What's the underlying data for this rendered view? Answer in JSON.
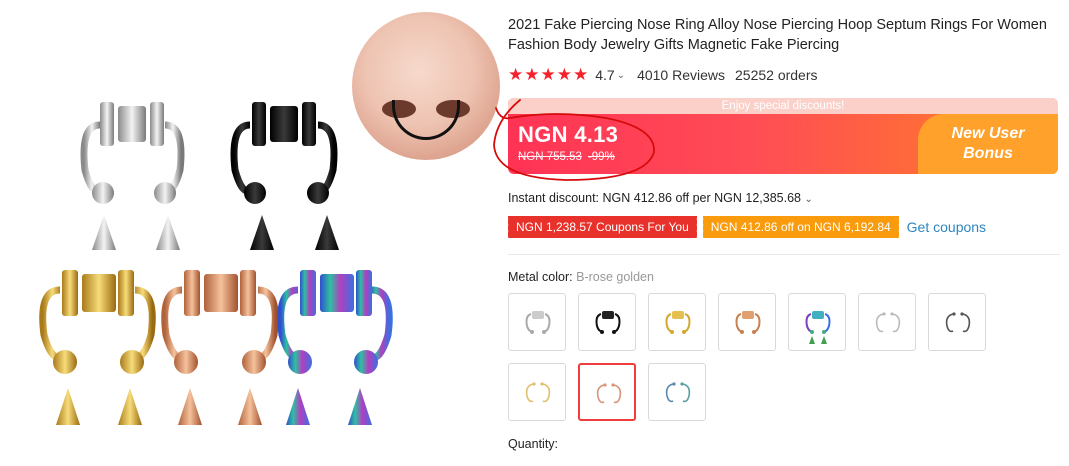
{
  "product": {
    "title": "2021 Fake Piercing Nose Ring Alloy Nose Piercing Hoop Septum Rings For Women Fashion Body Jewelry Gifts Magnetic Fake Piercing",
    "stars": "★★★★★",
    "rating": "4.7",
    "reviews": "4010 Reviews",
    "orders": "25252 orders"
  },
  "price": {
    "banner": "Enjoy special discounts!",
    "current": "NGN 4.13",
    "original": "NGN 755.53",
    "discount": "-99%",
    "bonus_line1": "New User",
    "bonus_line2": "Bonus"
  },
  "instant_discount": "Instant discount: NGN 412.86 off per NGN 12,385.68",
  "coupons": {
    "coupon1": "NGN 1,238.57 Coupons For You",
    "coupon2": "NGN 412.86 off on NGN 6,192.84",
    "get_coupons": "Get coupons"
  },
  "metal": {
    "label": "Metal color:",
    "selected": "B-rose golden"
  },
  "quantity_label": "Quantity:",
  "colors": {
    "accent_red": "#ff3355",
    "bonus_orange": "#ffa12b",
    "coupon_red": "#e8312a",
    "coupon_orange": "#f99b0c",
    "link_blue": "#2e86c1"
  }
}
